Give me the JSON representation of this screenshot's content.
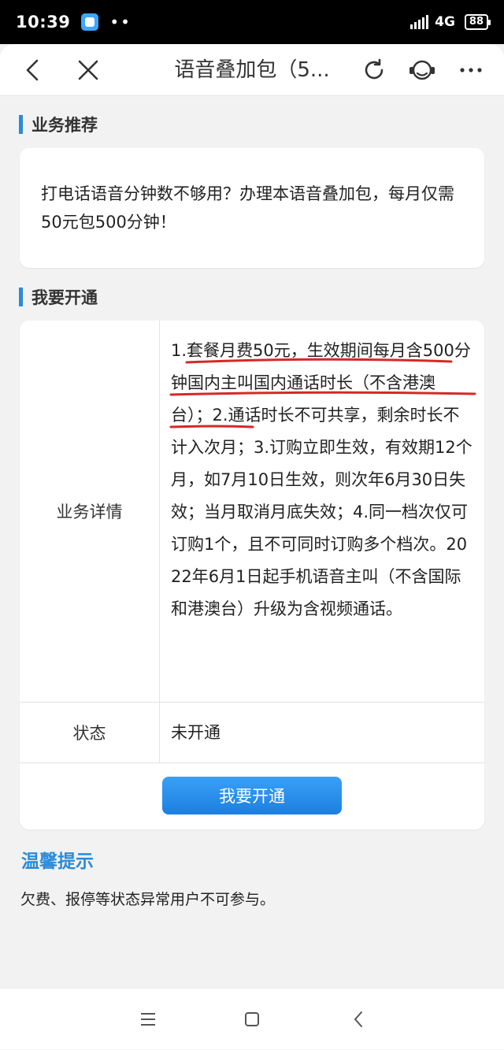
{
  "status_bar": {
    "time": "10:39",
    "dots": "••",
    "network": "4G",
    "battery": "88"
  },
  "header": {
    "title": "语音叠加包（5...",
    "icons": [
      "back-icon",
      "close-icon",
      "refresh-icon",
      "customer-service-icon",
      "more-icon"
    ]
  },
  "recommend": {
    "heading": "业务推荐",
    "text": "打电话语音分钟数不够用？办理本语音叠加包，每月仅需50元包500分钟！"
  },
  "subscribe": {
    "heading": "我要开通",
    "detail_label": "业务详情",
    "detail_text": "1.套餐月费50元，生效期间每月含500分钟国内主叫国内通话时长（不含港澳台）；2.通话时长不可共享，剩余时长不计入次月；3.订购立即生效，有效期12个月，如7月10日生效，则次年6月30日失效；当月取消月底失效；4.同一档次仅可订购1个，且不可同时订购多个档次。2022年6月1日起手机语音主叫（不含国际和港澳台）升级为含视频通话。",
    "status_label": "状态",
    "status_value": "未开通",
    "button_label": "我要开通"
  },
  "tips": {
    "heading": "温馨提示",
    "text": "欠费、报停等状态异常用户不可参与。"
  },
  "colors": {
    "accent": "#2b8bd9",
    "button": "#1c7fe0",
    "annotation": "#d62828"
  },
  "nav": {
    "icons": [
      "menu-icon",
      "home-icon",
      "back-nav-icon"
    ]
  }
}
